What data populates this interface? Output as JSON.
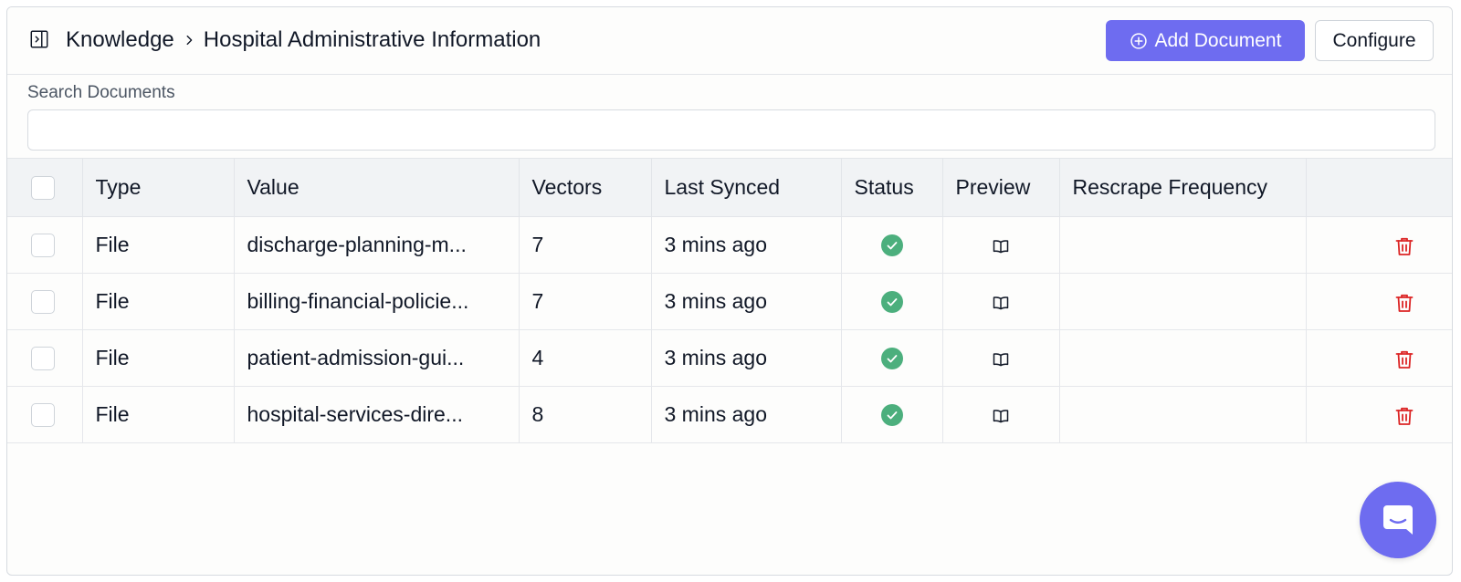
{
  "header": {
    "breadcrumb_root": "Knowledge",
    "breadcrumb_current": "Hospital Administrative Information",
    "add_document_label": "Add Document",
    "configure_label": "Configure"
  },
  "search": {
    "label": "Search Documents",
    "value": "",
    "placeholder": ""
  },
  "table": {
    "columns": [
      "Type",
      "Value",
      "Vectors",
      "Last Synced",
      "Status",
      "Preview",
      "Rescrape Frequency"
    ],
    "rows": [
      {
        "type": "File",
        "value": "discharge-planning-m...",
        "vectors": "7",
        "last_synced": "3 mins ago",
        "status": "success",
        "rescrape_frequency": ""
      },
      {
        "type": "File",
        "value": "billing-financial-policie...",
        "vectors": "7",
        "last_synced": "3 mins ago",
        "status": "success",
        "rescrape_frequency": ""
      },
      {
        "type": "File",
        "value": "patient-admission-gui...",
        "vectors": "4",
        "last_synced": "3 mins ago",
        "status": "success",
        "rescrape_frequency": ""
      },
      {
        "type": "File",
        "value": "hospital-services-dire...",
        "vectors": "8",
        "last_synced": "3 mins ago",
        "status": "success",
        "rescrape_frequency": ""
      }
    ]
  },
  "icons": {
    "sidebar_toggle": "panel-right-open-icon",
    "breadcrumb_separator": "chevron-right-icon",
    "add": "plus-circle-icon",
    "status_success": "check-circle-icon",
    "preview": "book-open-icon",
    "delete": "trash-icon",
    "chat": "chat-bubble-icon"
  },
  "colors": {
    "accent": "#6e6cf0",
    "success": "#4caf7d",
    "danger": "#dc2626",
    "header_bg": "#f1f3f5",
    "border": "#e2e5e9"
  }
}
